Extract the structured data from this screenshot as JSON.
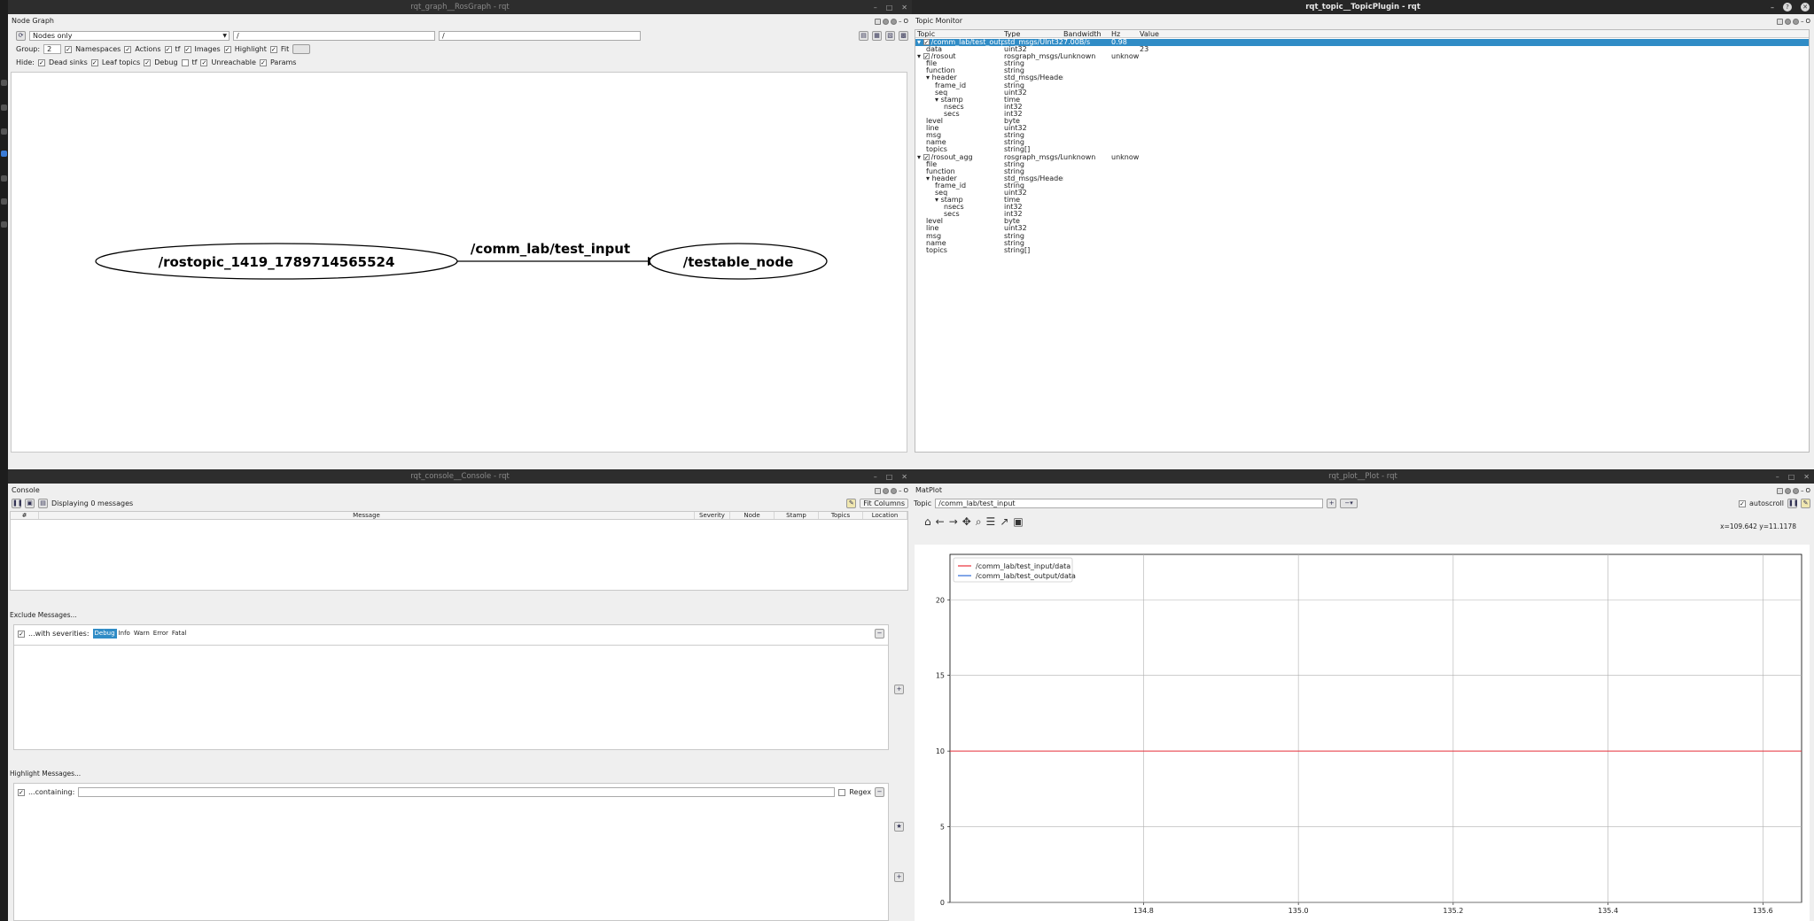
{
  "windows": {
    "graph": {
      "title": "rqt_graph__RosGraph - rqt"
    },
    "topic": {
      "title": "rqt_topic__TopicPlugin - rqt"
    },
    "console": {
      "title": "rqt_console__Console - rqt"
    },
    "plot": {
      "title": "rqt_plot__Plot - rqt"
    }
  },
  "graph": {
    "plugin_label": "Node Graph",
    "mode": "Nodes only",
    "filter1": "/",
    "filter2": "/",
    "group_label": "Group:",
    "group_value": "2",
    "namespaces": "Namespaces",
    "actions": "Actions",
    "tf": "tf",
    "images": "Images",
    "highlight": "Highlight",
    "fit": "Fit",
    "hide_label": "Hide:",
    "dead_sinks": "Dead sinks",
    "leaf_topics": "Leaf topics",
    "debug": "Debug",
    "tf2": "tf",
    "unreachable": "Unreachable",
    "params": "Params",
    "node_left": "/rostopic_1419_1789714565524",
    "edge_label": "/comm_lab/test_input",
    "node_right": "/testable_node"
  },
  "topic": {
    "plugin_label": "Topic Monitor",
    "headers": [
      "Topic",
      "Type",
      "Bandwidth",
      "Hz",
      "Value"
    ],
    "rows": [
      [
        "/comm_lab/test_outp...",
        "std_msgs/UInt32",
        "7.00B/s",
        "0.98",
        ""
      ],
      [
        "data",
        "uint32",
        "",
        "",
        "23"
      ],
      [
        "/rosout",
        "rosgraph_msgs/Log",
        "unknown",
        "unknown",
        ""
      ],
      [
        "file",
        "string",
        "",
        "",
        ""
      ],
      [
        "function",
        "string",
        "",
        "",
        ""
      ],
      [
        "header",
        "std_msgs/Header",
        "",
        "",
        ""
      ],
      [
        "frame_id",
        "string",
        "",
        "",
        ""
      ],
      [
        "seq",
        "uint32",
        "",
        "",
        ""
      ],
      [
        "stamp",
        "time",
        "",
        "",
        ""
      ],
      [
        "nsecs",
        "int32",
        "",
        "",
        ""
      ],
      [
        "secs",
        "int32",
        "",
        "",
        ""
      ],
      [
        "level",
        "byte",
        "",
        "",
        ""
      ],
      [
        "line",
        "uint32",
        "",
        "",
        ""
      ],
      [
        "msg",
        "string",
        "",
        "",
        ""
      ],
      [
        "name",
        "string",
        "",
        "",
        ""
      ],
      [
        "topics",
        "string[]",
        "",
        "",
        ""
      ],
      [
        "/rosout_agg",
        "rosgraph_msgs/Log",
        "unknown",
        "unknown",
        ""
      ],
      [
        "file",
        "string",
        "",
        "",
        ""
      ],
      [
        "function",
        "string",
        "",
        "",
        ""
      ],
      [
        "header",
        "std_msgs/Header",
        "",
        "",
        ""
      ],
      [
        "frame_id",
        "string",
        "",
        "",
        ""
      ],
      [
        "seq",
        "uint32",
        "",
        "",
        ""
      ],
      [
        "stamp",
        "time",
        "",
        "",
        ""
      ],
      [
        "nsecs",
        "int32",
        "",
        "",
        ""
      ],
      [
        "secs",
        "int32",
        "",
        "",
        ""
      ],
      [
        "level",
        "byte",
        "",
        "",
        ""
      ],
      [
        "line",
        "uint32",
        "",
        "",
        ""
      ],
      [
        "msg",
        "string",
        "",
        "",
        ""
      ],
      [
        "name",
        "string",
        "",
        "",
        ""
      ],
      [
        "topics",
        "string[]",
        "",
        "",
        ""
      ]
    ]
  },
  "console": {
    "plugin_label": "Console",
    "displaying": "Displaying 0 messages",
    "fit_columns": "Fit Columns",
    "columns": [
      "#",
      "Message",
      "Severity",
      "Node",
      "Stamp",
      "Topics",
      "Location"
    ],
    "exclude_label": "Exclude Messages...",
    "with_severities": "...with severities:",
    "severities": [
      "Debug",
      "Info",
      "Warn",
      "Error",
      "Fatal"
    ],
    "highlight_label": "Highlight Messages...",
    "containing": "...containing:",
    "regex": "Regex"
  },
  "plot": {
    "plugin_label": "MatPlot",
    "topic_label": "Topic",
    "topic_value": "/comm_lab/test_input",
    "autoscroll": "autoscroll",
    "coords": "x=109.642     y=11.1178"
  },
  "chart_data": {
    "type": "line",
    "series": [
      {
        "name": "/comm_lab/test_input/data",
        "color": "#e8303a",
        "x": [
          134.55,
          135.65
        ],
        "y": [
          10,
          10
        ]
      },
      {
        "name": "/comm_lab/test_output/data",
        "color": "#2f6bd8",
        "x": [],
        "y": []
      }
    ],
    "xlim": [
      134.55,
      135.65
    ],
    "ylim": [
      0,
      23
    ],
    "xticks": [
      "134.8",
      "135.0",
      "135.2",
      "135.4",
      "135.6"
    ],
    "yticks": [
      "0",
      "5",
      "10",
      "15",
      "20"
    ],
    "grid": true,
    "legend": "top-left"
  }
}
